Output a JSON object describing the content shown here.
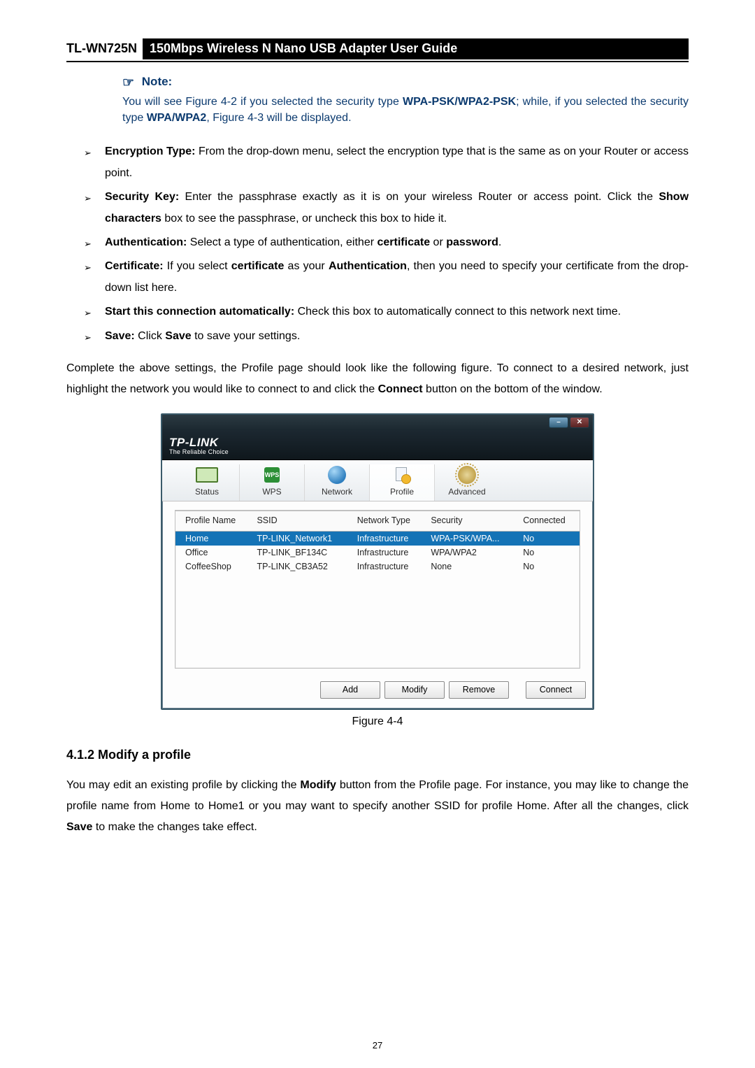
{
  "header": {
    "model": "TL-WN725N",
    "title": "150Mbps Wireless N Nano USB Adapter User Guide"
  },
  "note": {
    "label": "Note:",
    "body_parts": [
      "You will see Figure 4-2 if you selected the security type ",
      "WPA-PSK/WPA2-PSK",
      "; while, if you selected the security type ",
      "WPA/WPA2",
      ", Figure 4-3 will be displayed."
    ]
  },
  "bullets": {
    "encryption": {
      "label": "Encryption Type:",
      "text": " From the drop-down menu, select the encryption type that is the same as on your Router or access point."
    },
    "security_key": {
      "label": "Security Key:",
      "text1": " Enter the passphrase exactly as it is on your wireless Router or access point. Click the ",
      "bold1": "Show characters",
      "text2": " box to see the passphrase, or uncheck this box to hide it."
    },
    "authentication": {
      "label": "Authentication:",
      "text1": " Select a type of authentication, either ",
      "bold1": "certificate",
      "text2": " or ",
      "bold2": "password",
      "text3": "."
    },
    "certificate": {
      "label": "Certificate:",
      "text1": " If you select ",
      "bold1": "certificate",
      "text2": " as your ",
      "bold2": "Authentication",
      "text3": ", then you need to specify your certificate from the drop-down list here."
    },
    "start_auto": {
      "label": "Start this connection automatically:",
      "text": " Check this box to automatically connect to this network next time."
    },
    "save": {
      "label": "Save:",
      "text1": " Click ",
      "bold1": "Save",
      "text2": " to save your settings."
    }
  },
  "paragraph_after_list": {
    "text1": "Complete the above settings, the Profile page should look like the following figure. To connect to a desired network, just highlight the network you would like to connect to and click the ",
    "bold1": "Connect",
    "text2": " button on the bottom of the window."
  },
  "utility": {
    "brand": "TP-LINK",
    "brand_sub": "The Reliable Choice",
    "window_buttons": {
      "min": "–",
      "close": "✕"
    },
    "tabs": {
      "status": "Status",
      "wps": "WPS",
      "network": "Network",
      "profile": "Profile",
      "advanced": "Advanced"
    },
    "columns": {
      "profile_name": "Profile Name",
      "ssid": "SSID",
      "network_type": "Network Type",
      "security": "Security",
      "connected": "Connected"
    },
    "rows": [
      {
        "profile_name": "Home",
        "ssid": "TP-LINK_Network1",
        "network_type": "Infrastructure",
        "security": "WPA-PSK/WPA...",
        "connected": "No",
        "selected": true
      },
      {
        "profile_name": "Office",
        "ssid": "TP-LINK_BF134C",
        "network_type": "Infrastructure",
        "security": "WPA/WPA2",
        "connected": "No",
        "selected": false
      },
      {
        "profile_name": "CoffeeShop",
        "ssid": "TP-LINK_CB3A52",
        "network_type": "Infrastructure",
        "security": "None",
        "connected": "No",
        "selected": false
      }
    ],
    "buttons": {
      "add": "Add",
      "modify": "Modify",
      "remove": "Remove",
      "connect": "Connect"
    }
  },
  "figure_caption": "Figure 4-4",
  "section_heading": "4.1.2  Modify a profile",
  "paragraph2": {
    "text1": "You may edit an existing profile by clicking the ",
    "bold1": "Modify",
    "text2": " button from the Profile page. For instance, you may like to change the profile name from Home to Home1 or you may want to specify another SSID for profile Home. After all the changes, click ",
    "bold2": "Save",
    "text3": " to make the changes take effect."
  },
  "page_number": "27"
}
